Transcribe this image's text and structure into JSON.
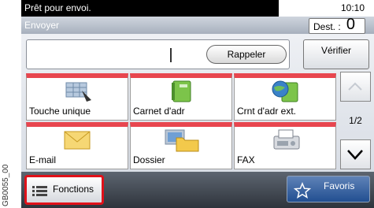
{
  "side_code": "GB0055_00",
  "status": {
    "message": "Prêt pour envoi.",
    "time": "10:10"
  },
  "title": "Envoyer",
  "destination": {
    "label": "Dest. :",
    "count": "0"
  },
  "address_field": {
    "value": ""
  },
  "buttons": {
    "recall": "Rappeler",
    "check": "Vérifier"
  },
  "tiles": [
    {
      "label": "Touche unique",
      "icon": "one-touch-key-icon"
    },
    {
      "label": "Carnet d'adr",
      "icon": "address-book-icon"
    },
    {
      "label": "Crnt d'adr ext.",
      "icon": "external-address-book-icon"
    },
    {
      "label": "E-mail",
      "icon": "envelope-icon"
    },
    {
      "label": "Dossier",
      "icon": "folder-icon"
    },
    {
      "label": "FAX",
      "icon": "fax-icon"
    }
  ],
  "pager": {
    "indicator": "1/2"
  },
  "bottom": {
    "functions": "Fonctions",
    "favorites": "Favoris"
  },
  "colors": {
    "tile_accent": "#e8464f",
    "highlight": "#e0111a",
    "favorites_blue": "#2f5c9e"
  }
}
